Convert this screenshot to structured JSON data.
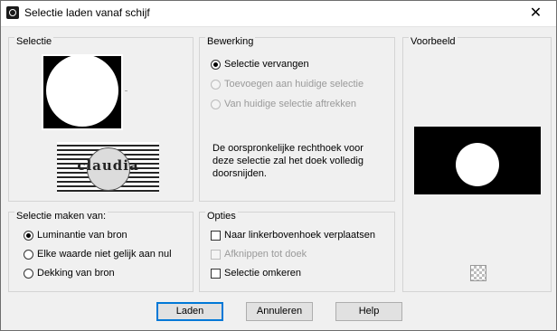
{
  "window": {
    "title": "Selectie laden vanaf schijf",
    "close_glyph": "✕"
  },
  "selectie": {
    "label": "Selectie",
    "watermark_text": "claudia"
  },
  "bewerking": {
    "label": "Bewerking",
    "options": [
      {
        "label": "Selectie vervangen",
        "checked": true,
        "enabled": true
      },
      {
        "label": "Toevoegen aan huidige selectie",
        "checked": false,
        "enabled": false
      },
      {
        "label": "Van huidige selectie aftrekken",
        "checked": false,
        "enabled": false
      }
    ],
    "description": "De oorspronkelijke rechthoek voor deze selectie zal het doek volledig doorsnijden."
  },
  "voorbeeld": {
    "label": "Voorbeeld"
  },
  "maken": {
    "label": "Selectie maken van:",
    "options": [
      {
        "label": "Luminantie van bron",
        "checked": true
      },
      {
        "label": "Elke waarde niet gelijk aan nul",
        "checked": false
      },
      {
        "label": "Dekking van bron",
        "checked": false
      }
    ]
  },
  "opties": {
    "label": "Opties",
    "items": [
      {
        "label": "Naar linkerbovenhoek verplaatsen",
        "checked": false,
        "enabled": true
      },
      {
        "label": "Afknippen tot doek",
        "checked": false,
        "enabled": false
      },
      {
        "label": "Selectie omkeren",
        "checked": false,
        "enabled": true
      }
    ]
  },
  "buttons": {
    "load": "Laden",
    "cancel": "Annuleren",
    "help": "Help"
  }
}
